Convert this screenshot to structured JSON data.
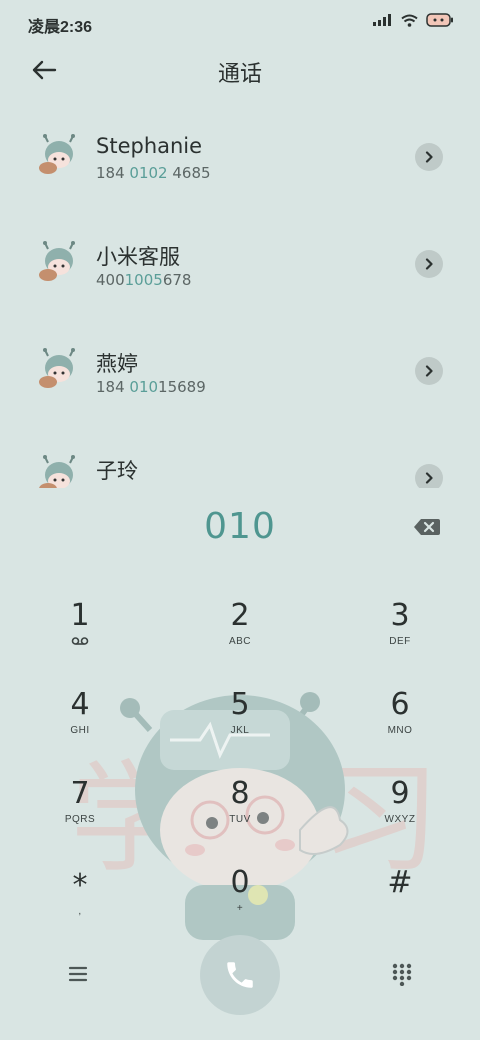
{
  "status_bar": {
    "time": "凌晨2:36",
    "icons": [
      "signal-icon",
      "wifi-icon",
      "battery-icon"
    ]
  },
  "header": {
    "title": "通话",
    "back_icon": "arrow-left-icon"
  },
  "contacts": [
    {
      "name": "Stephanie",
      "number_prefix": "184 ",
      "number_match": "0102",
      "number_suffix": " 4685"
    },
    {
      "name": "小米客服",
      "number_prefix": "400",
      "number_match": "1005",
      "number_suffix": "678"
    },
    {
      "name": "燕婷",
      "number_prefix": "184 ",
      "number_match": "010",
      "number_suffix": "15689"
    },
    {
      "name": "子玲",
      "number_prefix": "",
      "number_match": "",
      "number_suffix": ""
    }
  ],
  "dialer": {
    "input": "010",
    "backspace_icon": "backspace-icon"
  },
  "keypad": [
    {
      "digit": "1",
      "letters": "",
      "sub_icon": "voicemail-icon"
    },
    {
      "digit": "2",
      "letters": "ABC"
    },
    {
      "digit": "3",
      "letters": "DEF"
    },
    {
      "digit": "4",
      "letters": "GHI"
    },
    {
      "digit": "5",
      "letters": "JKL"
    },
    {
      "digit": "6",
      "letters": "MNO"
    },
    {
      "digit": "7",
      "letters": "PQRS"
    },
    {
      "digit": "8",
      "letters": "TUV"
    },
    {
      "digit": "9",
      "letters": "WXYZ"
    },
    {
      "digit": "*",
      "letters": ","
    },
    {
      "digit": "0",
      "letters": "+"
    },
    {
      "digit": "#",
      "letters": ""
    }
  ],
  "bottom_bar": {
    "menu_icon": "menu-icon",
    "call_icon": "phone-icon",
    "dialpad_icon": "dialpad-icon"
  },
  "colors": {
    "background": "#d9e5e3",
    "accent": "#4f9690",
    "call_button": "#c3d3d2"
  }
}
